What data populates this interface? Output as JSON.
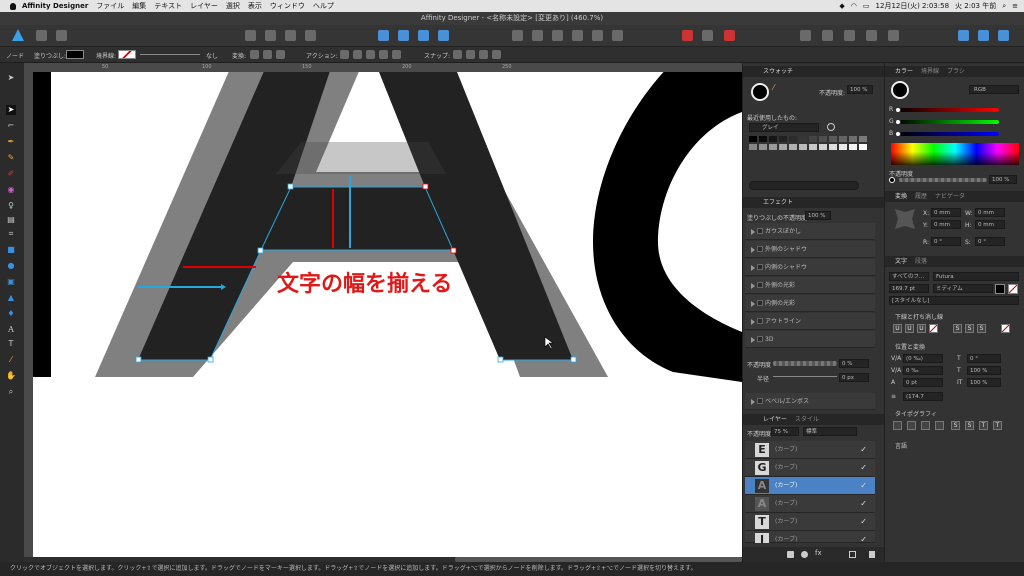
{
  "menubar": {
    "apple": "",
    "app": "Affinity Designer",
    "items": [
      "ファイル",
      "編集",
      "テキスト",
      "レイヤー",
      "選択",
      "表示",
      "ウィンドウ",
      "ヘルプ"
    ],
    "clock": "12月12日(火) 2:03:58",
    "clock2": "火 2:03 午前"
  },
  "window": {
    "title": "Affinity Designer - <名称未設定> [変更あり] (460.7%)"
  },
  "context": {
    "tool": "ノード",
    "fill_label": "塗りつぶし:",
    "stroke_label": "境界線:",
    "none": "なし",
    "transform_label": "変換:",
    "action_label": "アクション:",
    "snap_label": "スナップ:"
  },
  "ruler": {
    "ticks": [
      "50",
      "100",
      "150",
      "200",
      "250"
    ]
  },
  "canvas": {
    "annotation": "文字の幅を揃える",
    "colors": {
      "letter": "#222222",
      "shadow": "#808080",
      "guide_red": "#e00000",
      "guide_blue": "#29a6e0",
      "annotation": "#e01818"
    }
  },
  "swatches": {
    "tab": "スウォッチ",
    "opacity_label": "不透明度:",
    "opacity": "100 %",
    "recent_label": "最近使用したもの:",
    "palette": "グレイ"
  },
  "effects": {
    "tab": "エフェクト",
    "opacity_label": "塗りつぶしの不透明度:",
    "opacity": "100 %",
    "items": [
      "ガウスぼかし",
      "外側のシャドウ",
      "内側のシャドウ",
      "外側の光彩",
      "内側の光彩",
      "アウトライン",
      "3D"
    ],
    "bevel": "ベベル/エンボス",
    "sub_opacity_label": "不透明度",
    "sub_opacity": "0 %",
    "radius_label": "半径",
    "radius": "0 px"
  },
  "layers": {
    "tab": "レイヤー",
    "tab2": "スタイル",
    "opacity_label": "不透明度:",
    "opacity": "75 %",
    "blend": "標準",
    "items": [
      {
        "glyph": "E",
        "label": "(カーブ)"
      },
      {
        "glyph": "G",
        "label": "(カーブ)"
      },
      {
        "glyph": "A",
        "label": "(カーブ)"
      },
      {
        "glyph": "A",
        "label": "(カーブ)"
      },
      {
        "glyph": "T",
        "label": "(カーブ)"
      },
      {
        "glyph": "I",
        "label": "(カーブ)"
      }
    ],
    "check": "✓"
  },
  "color": {
    "tab": "カラー",
    "tab2": "境界線",
    "tab3": "ブラシ",
    "mode": "RGB",
    "r": "R",
    "g": "G",
    "b": "B",
    "opacity_label": "不透明度",
    "opacity": "100 %"
  },
  "transform": {
    "tab": "変換",
    "tab2": "履歴",
    "tab3": "ナビゲータ",
    "x_label": "X:",
    "x": "0 mm",
    "y_label": "Y:",
    "y": "0 mm",
    "w_label": "W:",
    "w": "0 mm",
    "h_label": "H:",
    "h": "0 mm",
    "r_label": "R:",
    "r": "0 °",
    "s_label": "S:",
    "s": "0 °"
  },
  "text": {
    "tab": "文字",
    "tab2": "段落",
    "fontset": "すべてのフ...",
    "font": "Futura",
    "size": "169.7 pt",
    "weight": "ミディアム",
    "style": "[スタイルなし]",
    "underline_label": "下線と打ち消し線",
    "pos_label": "位置と変換",
    "kerning": "(0 ‰)",
    "tracking": "0 ‰",
    "baseline": "0 pt",
    "leading": "(174.7",
    "skew": "0 °",
    "hscale": "100 %",
    "vscale": "100 %",
    "typo_label": "タイポグラフィ",
    "lang_label": "言語"
  },
  "status": "クリックでオブジェクトを選択します。クリック+⇧で選択に追加します。ドラッグでノードをマーキー選択します。ドラッグ+⇧でノードを選択に追加します。ドラッグ+⌥で選択からノードを削除します。ドラッグ+⇧+⌥でノード選択を切り替えます。"
}
